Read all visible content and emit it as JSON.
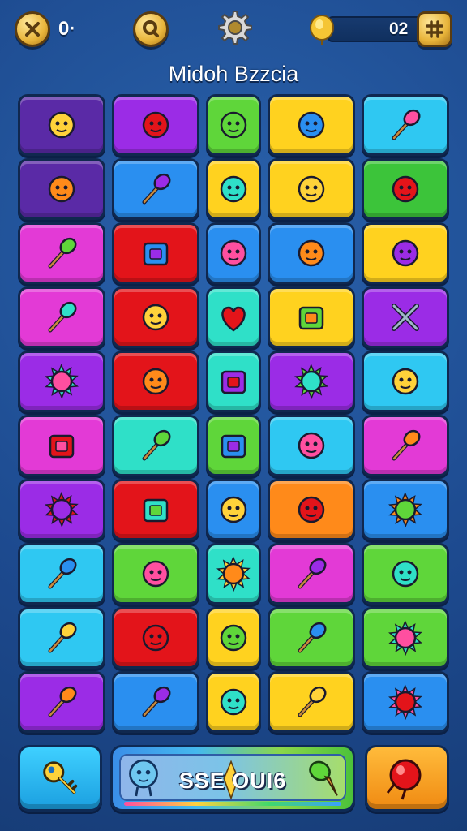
{
  "header": {
    "left_count": "0·",
    "coin_count": "02",
    "title": "Midoh Bzzcia"
  },
  "colors": {
    "purple_dark": "#5a2aa6",
    "purple": "#9b2ce6",
    "green": "#5fd63a",
    "yellow": "#ffd21f",
    "cyan": "#2fc8f2",
    "blue": "#2a8ff0",
    "magenta": "#e33ad6",
    "red": "#e3141a",
    "teal": "#2fe0c8",
    "orange": "#ff8a1a"
  },
  "grid": {
    "rows": [
      [
        {
          "color": "#5a2aa6",
          "icon": "green-monster-icon"
        },
        {
          "color": "#9b2ce6",
          "icon": "red-orb-icon"
        },
        {
          "color": "#5fd63a",
          "icon": "balloon-icon"
        },
        {
          "color": "#ffd21f",
          "icon": "green-potion-icon"
        },
        {
          "color": "#2fc8f2",
          "icon": "green-drop-icon"
        }
      ],
      [
        {
          "color": "#5a2aa6",
          "icon": "green-monster-icon"
        },
        {
          "color": "#2a8ff0",
          "icon": "brush-icon"
        },
        {
          "color": "#ffd21f",
          "icon": "blue-blob-icon"
        },
        {
          "color": "#ffd21f",
          "icon": "smiley-face-icon"
        },
        {
          "color": "#3cc43a",
          "icon": "purple-gem-icon"
        }
      ],
      [
        {
          "color": "#e33ad6",
          "icon": "ice-pop-icon"
        },
        {
          "color": "#e3141a",
          "icon": "easel-icon"
        },
        {
          "color": "#2a8ff0",
          "icon": "yellow-lock-icon"
        },
        {
          "color": "#2a8ff0",
          "icon": "green-flask-icon"
        },
        {
          "color": "#ffd21f",
          "icon": "red-berry-icon"
        }
      ],
      [
        {
          "color": "#e33ad6",
          "icon": "purple-drop-icon"
        },
        {
          "color": "#e3141a",
          "icon": "purple-fish-icon"
        },
        {
          "color": "#2fe0c8",
          "icon": "heart-icon"
        },
        {
          "color": "#ffd21f",
          "icon": "green-book-icon"
        },
        {
          "color": "#9b2ce6",
          "icon": "crossed-swords-icon"
        }
      ],
      [
        {
          "color": "#9b2ce6",
          "icon": "sun-icon"
        },
        {
          "color": "#e3141a",
          "icon": "leaf-icon"
        },
        {
          "color": "#2fe0c8",
          "icon": "treasure-map-icon"
        },
        {
          "color": "#9b2ce6",
          "icon": "sun-face-icon"
        },
        {
          "color": "#2fc8f2",
          "icon": "yellow-bubble-icon"
        }
      ],
      [
        {
          "color": "#e33ad6",
          "icon": "house-icon"
        },
        {
          "color": "#2fe0c8",
          "icon": "pink-lollipop-icon"
        },
        {
          "color": "#5fd63a",
          "icon": "toaster-icon"
        },
        {
          "color": "#2fc8f2",
          "icon": "shield-icon"
        },
        {
          "color": "#e33ad6",
          "icon": "syringe-icon"
        }
      ],
      [
        {
          "color": "#9b2ce6",
          "icon": "pink-flower-icon"
        },
        {
          "color": "#e3141a",
          "icon": "blue-bag-icon"
        },
        {
          "color": "#2a8ff0",
          "icon": "red-fish-icon"
        },
        {
          "color": "#ff8a1a",
          "icon": "green-bomb-icon"
        },
        {
          "color": "#2a8ff0",
          "icon": "green-splat-icon"
        }
      ],
      [
        {
          "color": "#2fc8f2",
          "icon": "yellow-key-icon"
        },
        {
          "color": "#5fd63a",
          "icon": "orange-bell-icon"
        },
        {
          "color": "#2fe0c8",
          "icon": "green-virus-icon"
        },
        {
          "color": "#e33ad6",
          "icon": "pink-cat-icon"
        },
        {
          "color": "#5fd63a",
          "icon": "red-leaf-icon"
        }
      ],
      [
        {
          "color": "#2fc8f2",
          "icon": "red-pin-icon"
        },
        {
          "color": "#e3141a",
          "icon": "yellow-star-icon"
        },
        {
          "color": "#ffd21f",
          "icon": "purple-devil-icon"
        },
        {
          "color": "#5fd63a",
          "icon": "carrot-icon"
        },
        {
          "color": "#5fd63a",
          "icon": "green-sun-icon"
        }
      ],
      [
        {
          "color": "#9b2ce6",
          "icon": "blue-pin-icon"
        },
        {
          "color": "#2a8ff0",
          "icon": "red-dart-icon"
        },
        {
          "color": "#ffd21f",
          "icon": "red-lamp-icon"
        },
        {
          "color": "#ffd21f",
          "icon": "green-cone-icon"
        },
        {
          "color": "#2a8ff0",
          "icon": "red-gear-icon"
        }
      ]
    ]
  },
  "footer": {
    "score_text": "SSE OUI6",
    "left_icon": "yellow-key-icon",
    "right_icon": "red-balloon-icon"
  }
}
